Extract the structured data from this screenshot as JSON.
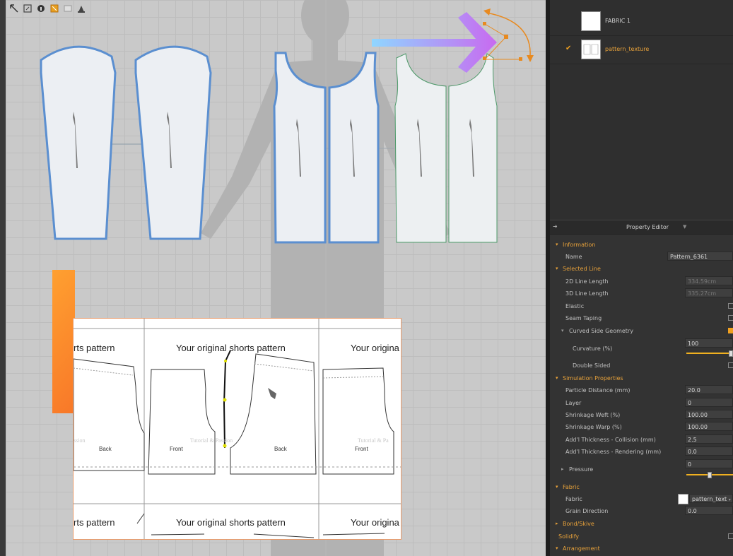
{
  "toolbar": {
    "icons": [
      "select-icon",
      "transform-icon",
      "info-icon",
      "fabric-icon",
      "texture-icon",
      "avatar-icon"
    ],
    "colors": [
      "#444444",
      "#666666",
      "#444444",
      "#e8a020",
      "#d6d6d6",
      "#555555"
    ]
  },
  "texture": {
    "heading_1": "rts pattern",
    "heading_2": "Your original shorts pattern",
    "heading_3": "Your origina",
    "heading_4": "rts pattern",
    "heading_5": "Your original shorts pattern",
    "heading_6": "Your origina",
    "label_back_1": "Back",
    "label_front_1": "Front",
    "label_back_2": "Back",
    "label_front_2": "Front",
    "watermark_1": "ssion",
    "watermark_2": "Tutorial & Passion",
    "watermark_3": "Tutorial & Pa"
  },
  "library": {
    "items": [
      {
        "label": "FABRIC 1",
        "selected": false
      },
      {
        "label": "pattern_texture",
        "selected": true
      }
    ]
  },
  "property_editor": {
    "title": "Property Editor",
    "information": "Information",
    "name_label": "Name",
    "name_value": "Pattern_6361",
    "selected_line": "Selected Line",
    "line2d_label": "2D Line Length",
    "line2d_value": "334.59cm",
    "line3d_label": "3D Line Length",
    "line3d_value": "335.27cm",
    "elastic_label": "Elastic",
    "seam_taping_label": "Seam Taping",
    "curved_side_label": "Curved Side Geometry",
    "curvature_label": "Curvature (%)",
    "curvature_value": "100",
    "curvature_level": 1.0,
    "double_sided_label": "Double Sided",
    "simulation": "Simulation Properties",
    "particle_label": "Particle Distance (mm)",
    "particle_value": "20.0",
    "layer_label": "Layer",
    "layer_value": "0",
    "weft_label": "Shrinkage Weft (%)",
    "weft_value": "100.00",
    "warp_label": "Shrinkage Warp (%)",
    "warp_value": "100.00",
    "collision_label": "Add'l Thickness - Collision (mm)",
    "collision_value": "2.5",
    "rendering_label": "Add'l Thickness - Rendering (mm)",
    "rendering_value": "0.0",
    "pressure_label": "Pressure",
    "pressure_value": "0",
    "pressure_level": 0.5,
    "fabric_section": "Fabric",
    "fabric_label": "Fabric",
    "fabric_value": "pattern_text",
    "grain_label": "Grain Direction",
    "grain_value": "0.0",
    "bond": "Bond/Skive",
    "solidify": "Solidify",
    "arrangement": "Arrangement"
  },
  "accent_color": "#e8a23a"
}
